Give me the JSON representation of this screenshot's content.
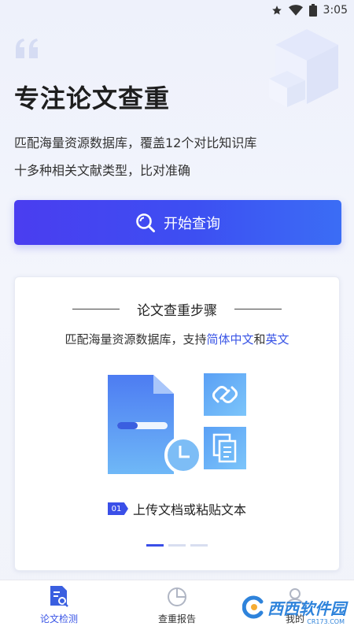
{
  "status_bar": {
    "time": "3:05",
    "icons": [
      "star-icon",
      "wifi-icon",
      "battery-icon"
    ]
  },
  "hero": {
    "title": "专注论文查重",
    "subtitle_line1": "匹配海量资源数据库，覆盖12个对比知识库",
    "subtitle_line2": "十多种相关文献类型，比对准确"
  },
  "search_button": {
    "label": "开始查询",
    "icon": "search-icon"
  },
  "steps_card": {
    "title": "论文查重步骤",
    "desc_prefix": "匹配海量资源数据库，支持",
    "desc_hl1": "简体中文",
    "desc_mid": "和",
    "desc_hl2": "英文",
    "step_number": "01",
    "step_text": "上传文档或粘贴文本",
    "pager_total": 3,
    "pager_active": 1
  },
  "nav": {
    "items": [
      {
        "label": "论文检测",
        "icon": "document-search-icon",
        "active": true
      },
      {
        "label": "查重报告",
        "icon": "pie-chart-icon",
        "active": false
      },
      {
        "label": "我的",
        "icon": "user-icon",
        "active": false
      }
    ]
  },
  "watermark": {
    "text": "西西软件园",
    "sub": "CR173.COM"
  },
  "colors": {
    "accent": "#3a4fe8",
    "highlight": "#3a55e6",
    "button_gradient_start": "#4a3df0",
    "button_gradient_end": "#3b6df5"
  }
}
